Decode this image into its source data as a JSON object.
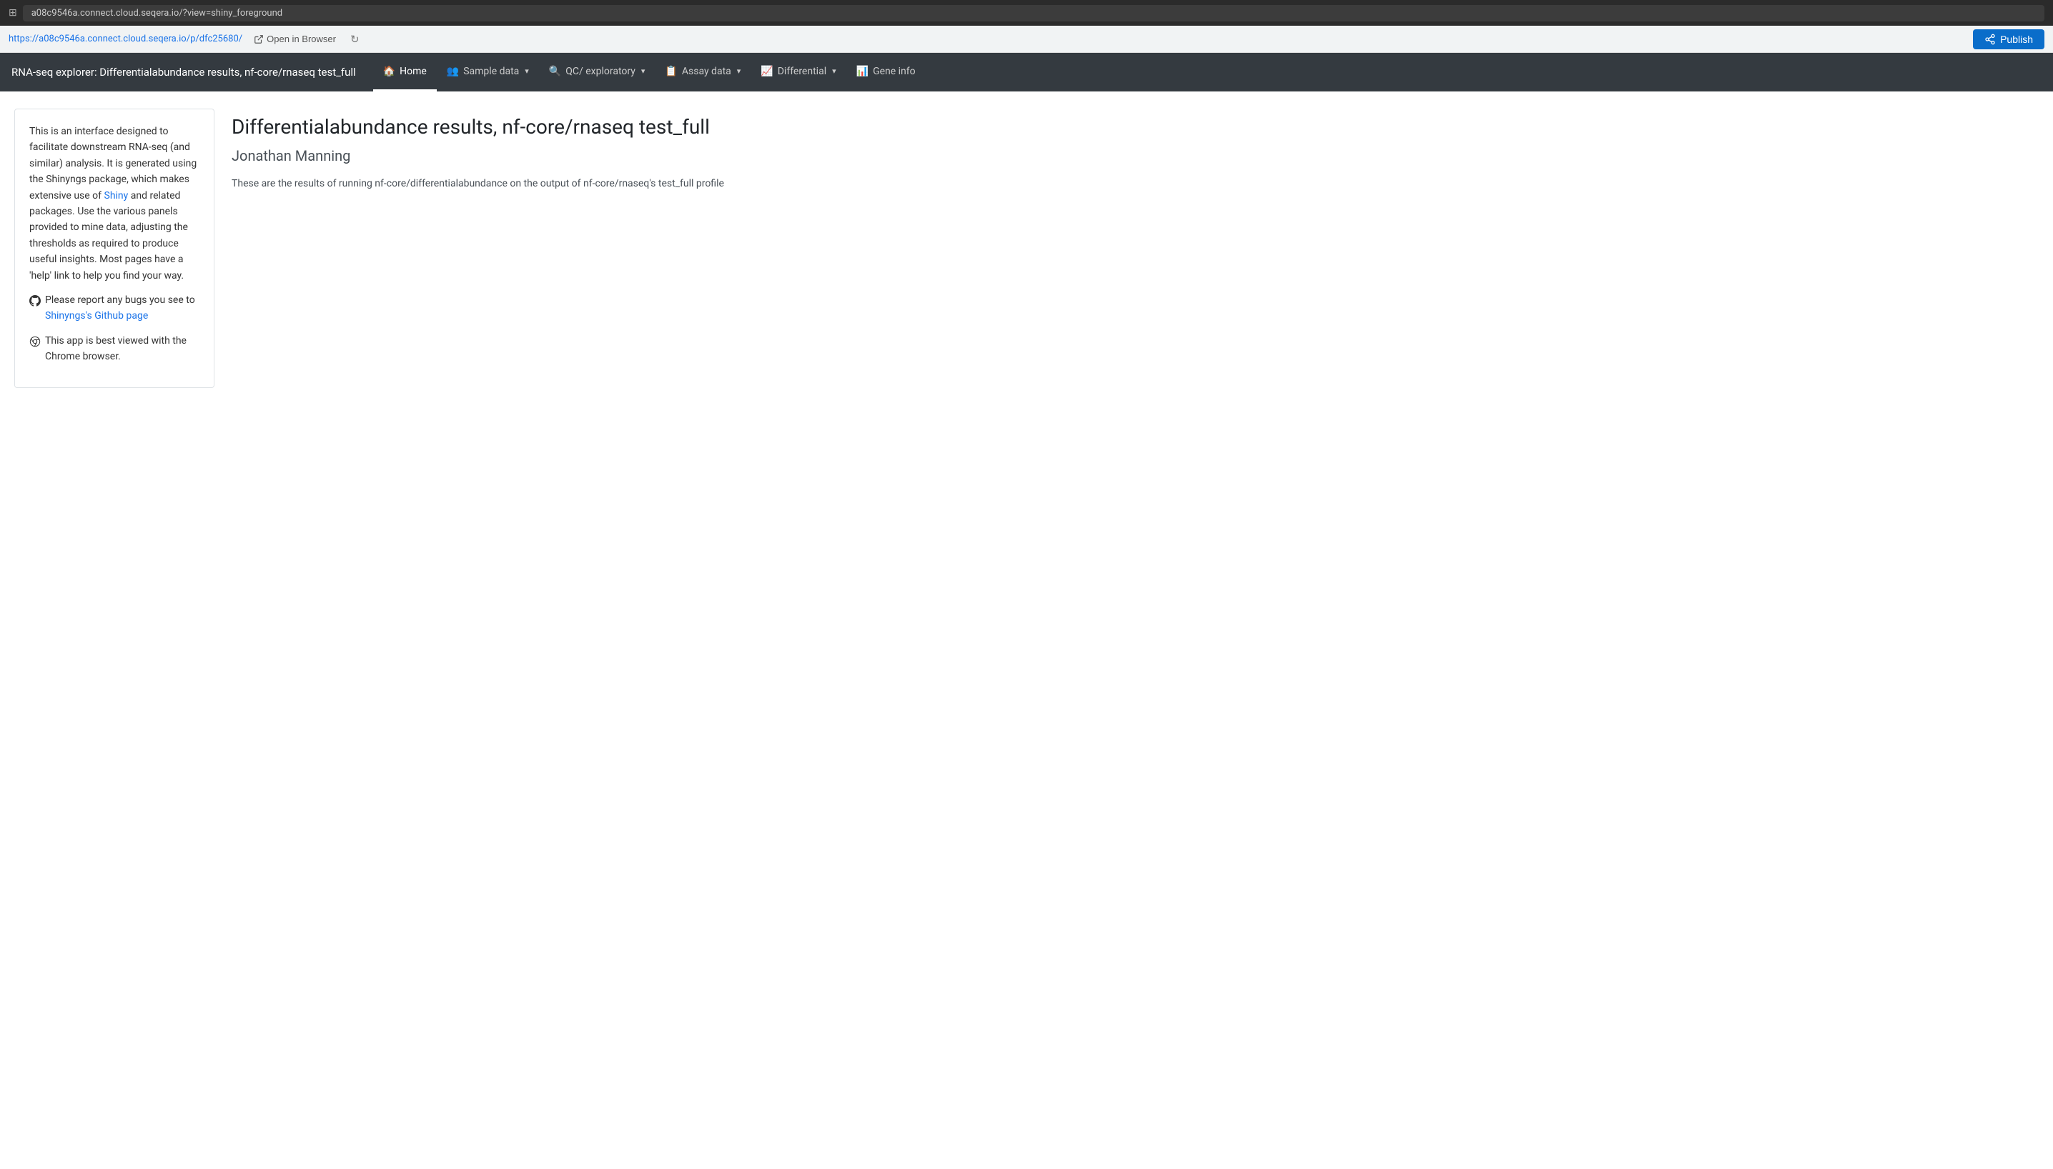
{
  "browser": {
    "url_display": "a08c9546a.connect.cloud.seqera.io/?view=shiny_foreground",
    "url_full": "https://a08c9546a.connect.cloud.seqera.io/p/dfc25680/",
    "address_label": "https://a08c9546a.connect.cloud.seqera.io/p/dfc25680/",
    "open_in_browser_label": "Open in Browser",
    "publish_label": "Publish"
  },
  "navbar": {
    "app_title": "RNA-seq explorer: Differentialabundance results, nf-core/rnaseq test_full",
    "items": [
      {
        "id": "home",
        "label": "Home",
        "icon": "🏠",
        "has_dropdown": false,
        "active": true
      },
      {
        "id": "sample-data",
        "label": "Sample data",
        "icon": "👤",
        "has_dropdown": true,
        "active": false
      },
      {
        "id": "qc-exploratory",
        "label": "QC/ exploratory",
        "icon": "🔍",
        "has_dropdown": true,
        "active": false
      },
      {
        "id": "assay-data",
        "label": "Assay data",
        "icon": "📋",
        "has_dropdown": true,
        "active": false
      },
      {
        "id": "differential",
        "label": "Differential",
        "icon": "📈",
        "has_dropdown": true,
        "active": false
      },
      {
        "id": "gene-info",
        "label": "Gene info",
        "icon": "📊",
        "has_dropdown": false,
        "active": false
      }
    ]
  },
  "sidebar": {
    "intro_text": "This is an interface designed to facilitate downstream RNA-seq (and similar) analysis. It is generated using the Shinyngs package, which makes extensive use of ",
    "shiny_link_text": "Shiny",
    "shiny_link_url": "#",
    "intro_text2": " and related packages. Use the various panels provided to mine data, adjusting the thresholds as required to produce useful insights. Most pages have a 'help' link to help you find your way.",
    "bug_report_prefix": "Please report any bugs you see to",
    "github_link_text": "Shinyngs's Github page",
    "github_link_url": "#",
    "chrome_note": "This app is best viewed with the Chrome browser."
  },
  "content": {
    "title": "Differentialabundance results, nf-core/rnaseq test_full",
    "author": "Jonathan Manning",
    "description": "These are the results of running nf-core/differentialabundance on the output of nf-core/rnaseq's test_full profile"
  }
}
